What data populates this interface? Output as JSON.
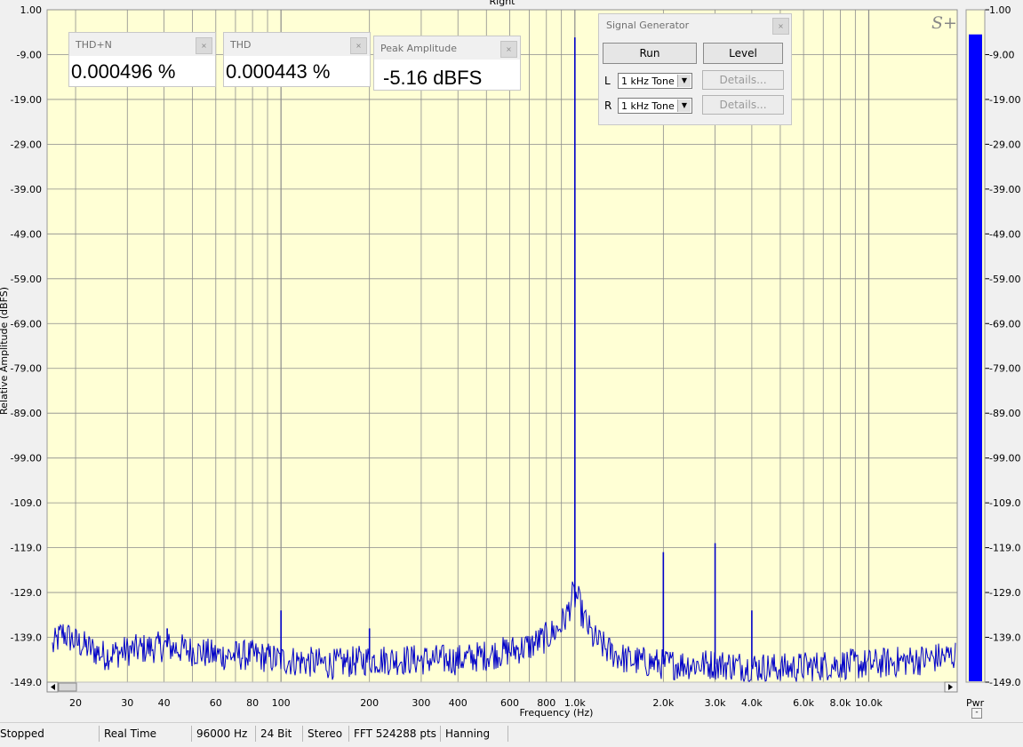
{
  "window_title": "Right",
  "logo": "S+",
  "chart_data": {
    "type": "line",
    "title": "Right",
    "xlabel": "Frequency (Hz)",
    "ylabel": "Relative Amplitude (dBFS)",
    "x_scale": "log",
    "xlim": [
      16,
      20000
    ],
    "ylim": [
      -149.0,
      1.0
    ],
    "y_ticks": [
      1.0,
      -9.0,
      -19.0,
      -29.0,
      -39.0,
      -49.0,
      -59.0,
      -69.0,
      -79.0,
      -89.0,
      -99.0,
      -109.0,
      -119.0,
      -129.0,
      -139.0,
      -149.0
    ],
    "y_tick_labels": [
      "1.00",
      "-9.00",
      "-19.00",
      "-29.00",
      "-39.00",
      "-49.00",
      "-59.00",
      "-69.00",
      "-79.00",
      "-89.00",
      "-99.00",
      "-109.0",
      "-119.0",
      "-129.0",
      "-139.0",
      "-149.0"
    ],
    "x_ticks": [
      20,
      30,
      40,
      60,
      80,
      100,
      200,
      300,
      400,
      600,
      800,
      1000,
      2000,
      3000,
      4000,
      6000,
      8000,
      10000
    ],
    "x_tick_labels": [
      "20",
      "30",
      "40",
      "60",
      "80",
      "100",
      "200",
      "300",
      "400",
      "600",
      "800",
      "1.0k",
      "2.0k",
      "3.0k",
      "4.0k",
      "6.0k",
      "8.0k",
      "10.0k"
    ],
    "grid": true,
    "series": [
      {
        "color": "#0000c8",
        "noise_floor": [
          [
            16,
            -143
          ],
          [
            18,
            -138
          ],
          [
            20,
            -140
          ],
          [
            25,
            -143
          ],
          [
            30,
            -142
          ],
          [
            40,
            -141
          ],
          [
            50,
            -142
          ],
          [
            60,
            -143
          ],
          [
            80,
            -143
          ],
          [
            100,
            -144
          ],
          [
            150,
            -145
          ],
          [
            200,
            -144
          ],
          [
            300,
            -144
          ],
          [
            400,
            -144
          ],
          [
            500,
            -143
          ],
          [
            600,
            -142
          ],
          [
            700,
            -141
          ],
          [
            800,
            -139
          ],
          [
            880,
            -137
          ],
          [
            940,
            -134
          ],
          [
            980,
            -130
          ],
          [
            1020,
            -130
          ],
          [
            1060,
            -134
          ],
          [
            1150,
            -139
          ],
          [
            1300,
            -142
          ],
          [
            1500,
            -144
          ],
          [
            2000,
            -145
          ],
          [
            3000,
            -145
          ],
          [
            5000,
            -146
          ],
          [
            8000,
            -145
          ],
          [
            10000,
            -145
          ],
          [
            15000,
            -144
          ],
          [
            20000,
            -143
          ]
        ],
        "peaks": [
          {
            "x": 1000,
            "y": -5.16
          },
          {
            "x": 3000,
            "y": -118
          },
          {
            "x": 2000,
            "y": -120
          },
          {
            "x": 4000,
            "y": -133
          },
          {
            "x": 100,
            "y": -133
          },
          {
            "x": 200,
            "y": -137
          },
          {
            "x": 41,
            "y": -137
          }
        ]
      }
    ]
  },
  "panels": [
    {
      "title": "THD+N",
      "value": "0.000496 %"
    },
    {
      "title": "THD",
      "value": "0.000443 %"
    },
    {
      "title": "Peak Amplitude",
      "value": "-5.16 dBFS"
    }
  ],
  "signal_generator": {
    "title": "Signal Generator",
    "run_label": "Run",
    "level_label": "Level",
    "left_label": "L",
    "right_label": "R",
    "left_tone": "1 kHz Tone",
    "right_tone": "1 kHz Tone",
    "details_label": "Details..."
  },
  "pwr_meter": {
    "label": "Pwr",
    "level_db": -4.5,
    "color": "#0000ff",
    "minus_label": "-"
  },
  "status_bar": [
    "Stopped",
    "Real Time",
    "96000 Hz",
    "24 Bit",
    "Stereo",
    "FFT 524288 pts",
    "Hanning"
  ],
  "colors": {
    "plot_bg": "#ffffd5",
    "grid": "#8c8c8c",
    "trace": "#0000c8"
  }
}
